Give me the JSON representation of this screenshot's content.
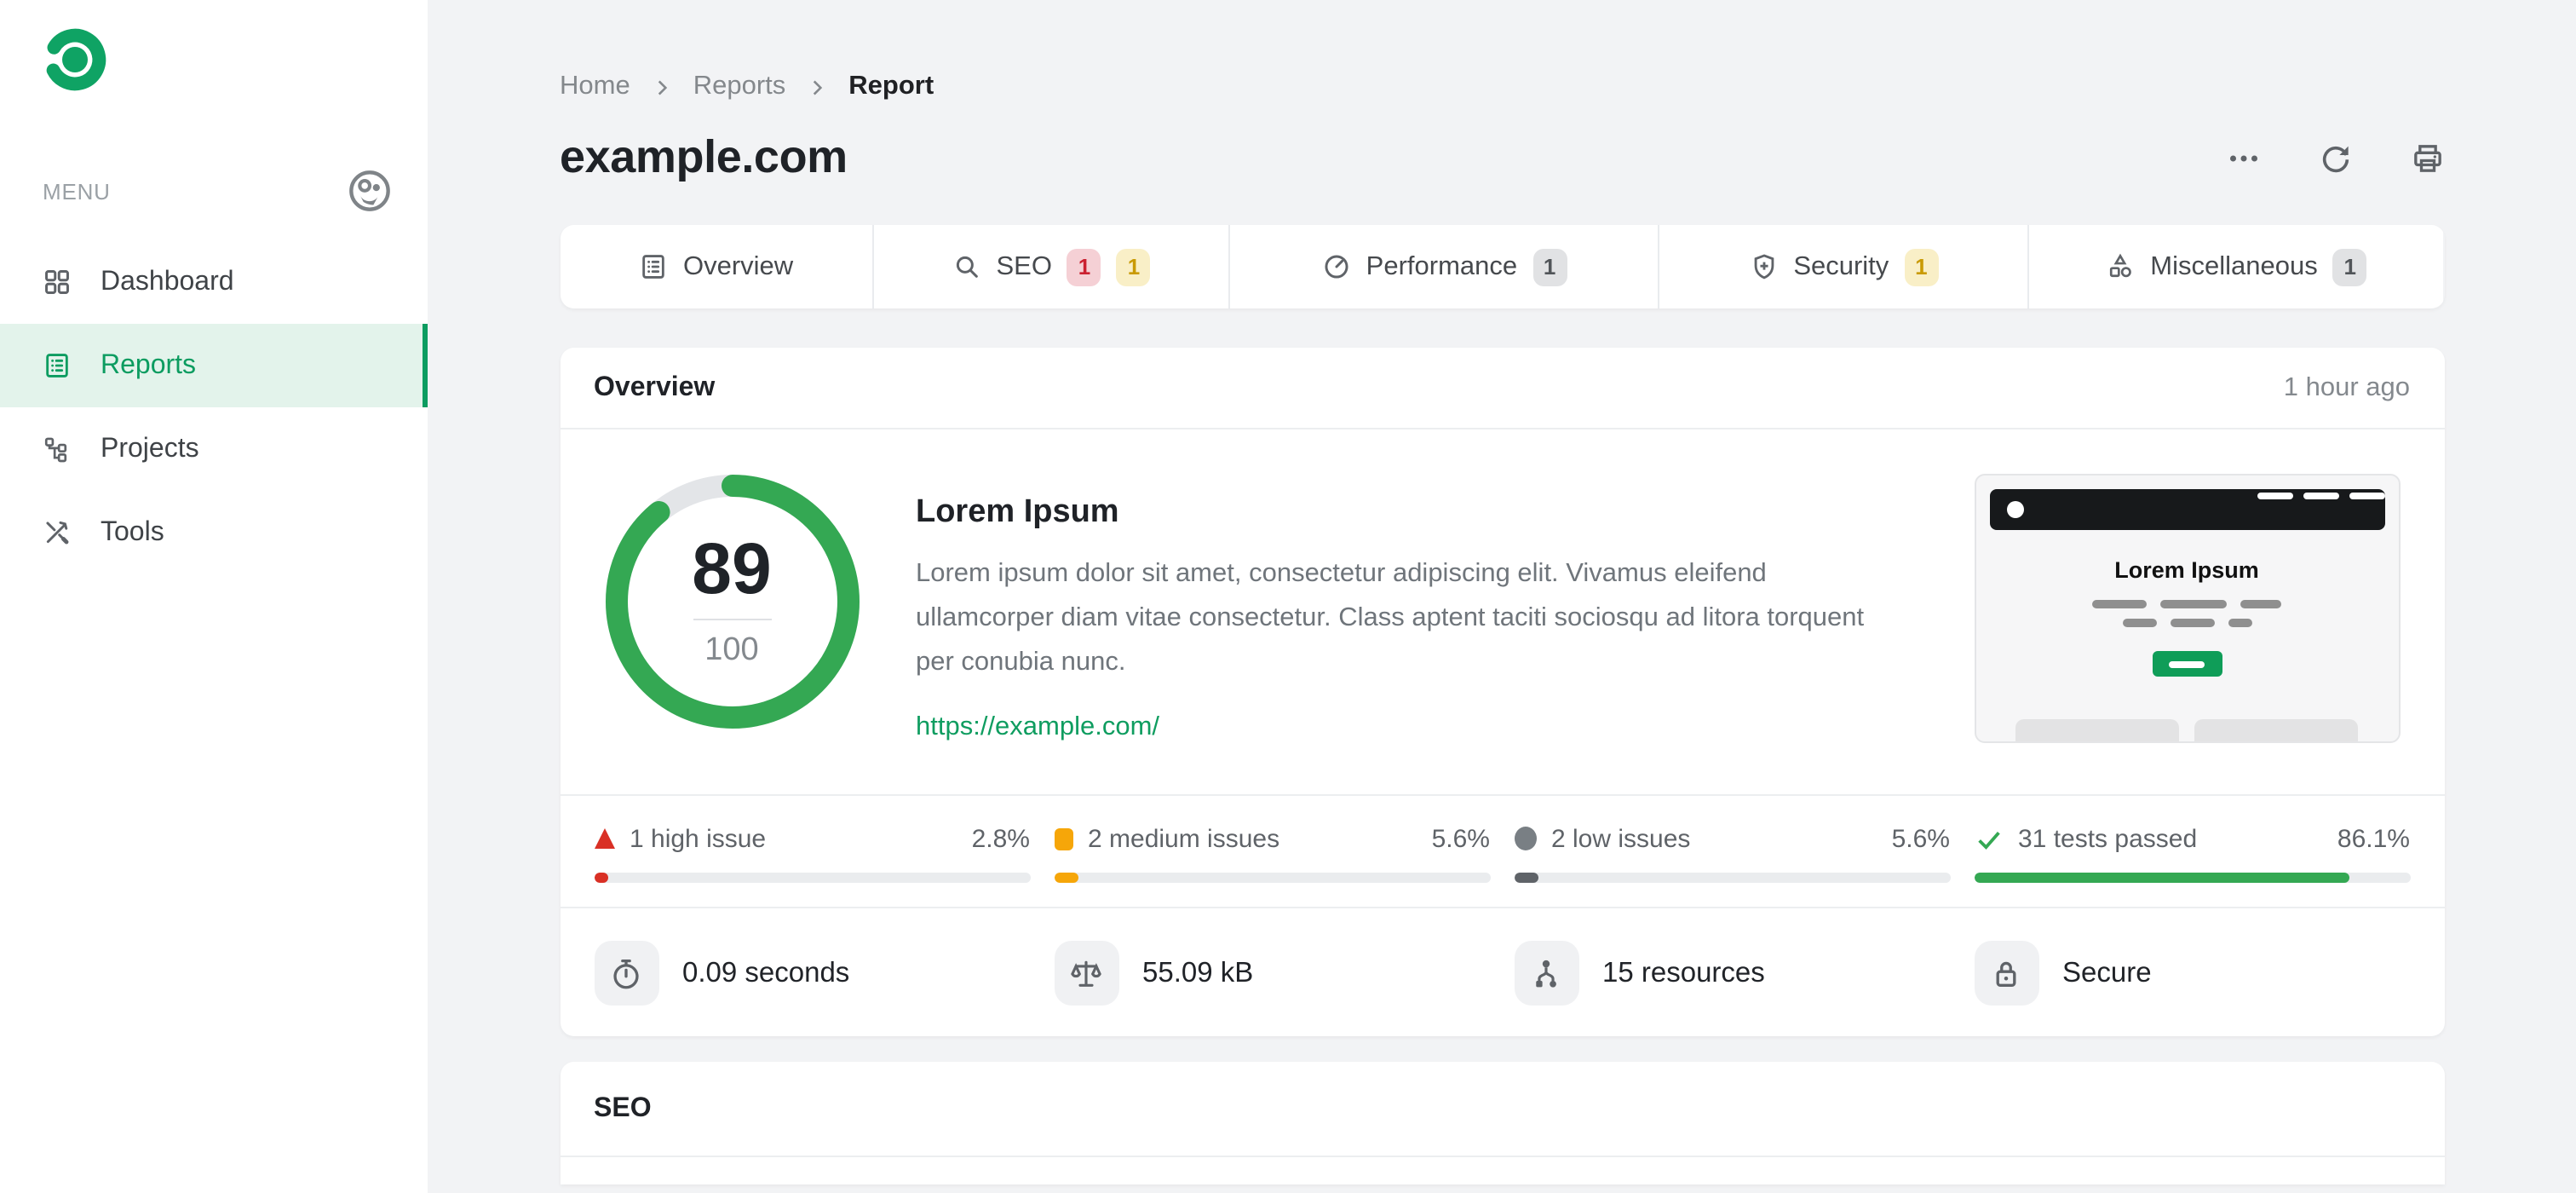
{
  "sidebar": {
    "menu_label": "MENU",
    "items": [
      {
        "label": "Dashboard",
        "icon": "grid-icon",
        "active": false
      },
      {
        "label": "Reports",
        "icon": "report-icon",
        "active": true
      },
      {
        "label": "Projects",
        "icon": "sitemap-icon",
        "active": false
      },
      {
        "label": "Tools",
        "icon": "tools-icon",
        "active": false
      }
    ]
  },
  "breadcrumb": {
    "items": [
      "Home",
      "Reports",
      "Report"
    ]
  },
  "page": {
    "title": "example.com"
  },
  "tabs": [
    {
      "label": "Overview",
      "badges": []
    },
    {
      "label": "SEO",
      "badges": [
        {
          "count": "1",
          "type": "high"
        },
        {
          "count": "1",
          "type": "medium"
        }
      ]
    },
    {
      "label": "Performance",
      "badges": [
        {
          "count": "1",
          "type": "neutral"
        }
      ]
    },
    {
      "label": "Security",
      "badges": [
        {
          "count": "1",
          "type": "medium"
        }
      ]
    },
    {
      "label": "Miscellaneous",
      "badges": [
        {
          "count": "1",
          "type": "neutral"
        }
      ]
    }
  ],
  "overview_card": {
    "title": "Overview",
    "timestamp": "1 hour ago",
    "score": {
      "value": "89",
      "max": "100"
    },
    "site": {
      "heading": "Lorem Ipsum",
      "description": "Lorem ipsum dolor sit amet, consectetur adipiscing elit. Vivamus eleifend ullamcorper diam vitae consectetur. Class aptent taciti sociosqu ad litora torquent per conubia nunc.",
      "url": "https://example.com/"
    },
    "preview": {
      "heading": "Lorem Ipsum"
    },
    "issues": [
      {
        "label": "1 high issue",
        "percent": "2.8%",
        "value": 2.8,
        "severity": "high"
      },
      {
        "label": "2 medium issues",
        "percent": "5.6%",
        "value": 5.6,
        "severity": "medium"
      },
      {
        "label": "2 low issues",
        "percent": "5.6%",
        "value": 5.6,
        "severity": "low"
      },
      {
        "label": "31 tests passed",
        "percent": "86.1%",
        "value": 86.1,
        "severity": "passed"
      }
    ],
    "quick_stats": [
      {
        "label": "0.09 seconds",
        "icon": "stopwatch-icon"
      },
      {
        "label": "55.09 kB",
        "icon": "scale-icon"
      },
      {
        "label": "15 resources",
        "icon": "resources-icon"
      },
      {
        "label": "Secure",
        "icon": "lock-icon"
      }
    ]
  },
  "seo_card": {
    "title": "SEO"
  },
  "colors": {
    "brand_green": "#0c9c60",
    "score_green": "#34a853",
    "high_red": "#d93025",
    "medium_amber": "#f6a609",
    "low_gray": "#5f6368",
    "badge_red_bg": "#f5d0d5",
    "badge_yellow_bg": "#f9efc7",
    "badge_gray_bg": "#e1e2e4",
    "active_item_bg": "#e3f3eb"
  }
}
